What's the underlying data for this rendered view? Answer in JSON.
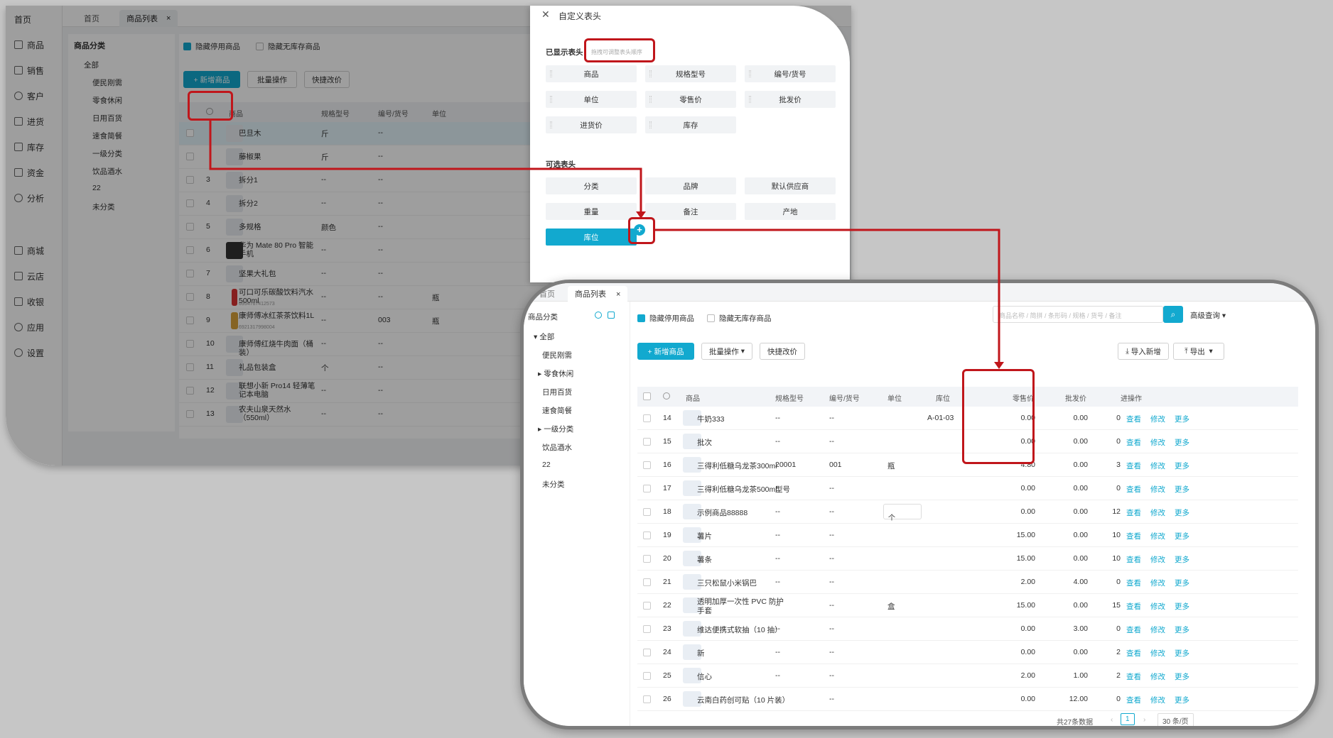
{
  "bg": {
    "tabs": [
      "首页",
      "商品列表"
    ],
    "nav": [
      "商品",
      "销售",
      "客户",
      "进货",
      "库存",
      "资金",
      "分析",
      "商城",
      "云店",
      "收银",
      "应用",
      "设置"
    ],
    "nav_cut": "首页",
    "category_title": "商品分类",
    "categories": [
      "全部",
      "便民刚需",
      "零食休闲",
      "日用百货",
      "速食简餐",
      "一级分类",
      "饮品酒水",
      "22",
      "未分类"
    ],
    "hide_disabled": "隐藏停用商品",
    "hide_nostock": "隐藏无库存商品",
    "add": "+ 新增商品",
    "batch": "批量操作",
    "quick_price": "快捷改价",
    "cols": [
      "商品",
      "规格型号",
      "编号/货号",
      "单位"
    ],
    "rows": [
      {
        "n": "",
        "name": "巴旦木",
        "spec": "斤",
        "code": "--",
        "unit": ""
      },
      {
        "n": "",
        "name": "藤椒果",
        "spec": "斤",
        "code": "--",
        "unit": ""
      },
      {
        "n": "3",
        "name": "拆分1",
        "spec": "--",
        "code": "--",
        "unit": ""
      },
      {
        "n": "4",
        "name": "拆分2",
        "spec": "--",
        "code": "--",
        "unit": ""
      },
      {
        "n": "5",
        "name": "多规格",
        "spec": "颜色",
        "code": "--",
        "unit": ""
      },
      {
        "n": "6",
        "name": "华为 Mate 80 Pro 智能手机",
        "spec": "--",
        "code": "--",
        "unit": ""
      },
      {
        "n": "7",
        "name": "坚果大礼包",
        "spec": "--",
        "code": "--",
        "unit": ""
      },
      {
        "n": "8",
        "name": "可口可乐碳酸饮料汽水500ml",
        "sub": "6954767412573",
        "spec": "--",
        "code": "--",
        "unit": "瓶"
      },
      {
        "n": "9",
        "name": "康师傅冰红茶茶饮料1L",
        "sub": "6921317998004",
        "spec": "--",
        "code": "003",
        "unit": "瓶"
      },
      {
        "n": "10",
        "name": "康师傅红烧牛肉面（桶装）",
        "spec": "--",
        "code": "--",
        "unit": ""
      },
      {
        "n": "11",
        "name": "礼品包装盒",
        "spec": "个",
        "code": "--",
        "unit": ""
      },
      {
        "n": "12",
        "name": "联想小新 Pro14 轻薄笔记本电脑",
        "spec": "--",
        "code": "--",
        "unit": ""
      },
      {
        "n": "13",
        "name": "农夫山泉天然水（550ml）",
        "spec": "--",
        "code": "--",
        "unit": ""
      }
    ]
  },
  "drawer": {
    "close": "✕",
    "title": "自定义表头",
    "shown_label": "已显示表头",
    "hint": "拖拽可调整表头顺序",
    "shown": [
      "商品",
      "规格型号",
      "编号/货号",
      "单位",
      "零售价",
      "批发价",
      "进货价",
      "库存"
    ],
    "optional_label": "可选表头",
    "optional": [
      "分类",
      "品牌",
      "默认供应商",
      "重量",
      "备注",
      "产地",
      "库位"
    ]
  },
  "fg": {
    "tabs": [
      "首页",
      "商品列表"
    ],
    "category_title": "商品分类",
    "categories": [
      "全部",
      "便民刚需",
      "零食休闲",
      "日用百货",
      "速食简餐",
      "一级分类",
      "饮品酒水",
      "22",
      "未分类"
    ],
    "hide_disabled": "隐藏停用商品",
    "hide_nostock": "隐藏无库存商品",
    "search_placeholder": "商品名称 / 简拼 / 条形码 / 规格 / 货号 / 备注",
    "adv": "高级查询",
    "add": "+ 新增商品",
    "batch": "批量操作",
    "quick_price": "快捷改价",
    "import": "导入新增",
    "export": "导出",
    "cols": {
      "name": "商品",
      "spec": "规格型号",
      "code": "编号/货号",
      "unit": "单位",
      "loc": "库位",
      "retail": "零售价",
      "whole": "批发价",
      "buy": "进",
      "op": "操作"
    },
    "actions": [
      "查看",
      "修改",
      "更多"
    ],
    "rows": [
      {
        "n": "14",
        "name": "牛奶333",
        "spec": "--",
        "code": "--",
        "unit": "",
        "loc": "A-01-03",
        "retail": "0.00",
        "whole": "0.00",
        "buy": "0"
      },
      {
        "n": "15",
        "name": "批次",
        "spec": "--",
        "code": "--",
        "unit": "",
        "loc": "",
        "retail": "0.00",
        "whole": "0.00",
        "buy": "0"
      },
      {
        "n": "16",
        "name": "三得利低糖乌龙茶300ml",
        "spec": "20001",
        "code": "001",
        "unit": "瓶",
        "loc": "",
        "retail": "4.80",
        "whole": "0.00",
        "buy": "3"
      },
      {
        "n": "17",
        "name": "三得利低糖乌龙茶500ml",
        "spec": "型号",
        "code": "--",
        "unit": "",
        "loc": "",
        "retail": "0.00",
        "whole": "0.00",
        "buy": "0"
      },
      {
        "n": "18",
        "name": "示例商品88888",
        "spec": "--",
        "code": "--",
        "unit": "个",
        "loc": "",
        "retail": "0.00",
        "whole": "0.00",
        "buy": "12"
      },
      {
        "n": "19",
        "name": "薯片",
        "spec": "--",
        "code": "--",
        "unit": "",
        "loc": "",
        "retail": "15.00",
        "whole": "0.00",
        "buy": "10"
      },
      {
        "n": "20",
        "name": "薯条",
        "spec": "--",
        "code": "--",
        "unit": "",
        "loc": "",
        "retail": "15.00",
        "whole": "0.00",
        "buy": "10"
      },
      {
        "n": "21",
        "name": "三只松鼠小米锅巴",
        "spec": "--",
        "code": "--",
        "unit": "",
        "loc": "",
        "retail": "2.00",
        "whole": "4.00",
        "buy": "0"
      },
      {
        "n": "22",
        "name": "透明加厚一次性 PVC 防护手套",
        "spec": "--",
        "code": "--",
        "unit": "盒",
        "loc": "",
        "retail": "15.00",
        "whole": "0.00",
        "buy": "15"
      },
      {
        "n": "23",
        "name": "维达便携式软抽（10 抽）",
        "spec": "--",
        "code": "--",
        "unit": "",
        "loc": "",
        "retail": "0.00",
        "whole": "3.00",
        "buy": "0"
      },
      {
        "n": "24",
        "name": "新",
        "spec": "--",
        "code": "--",
        "unit": "",
        "loc": "",
        "retail": "0.00",
        "whole": "0.00",
        "buy": "2"
      },
      {
        "n": "25",
        "name": "信心",
        "spec": "--",
        "code": "--",
        "unit": "",
        "loc": "",
        "retail": "2.00",
        "whole": "1.00",
        "buy": "2"
      },
      {
        "n": "26",
        "name": "云南白药创可贴（10 片装）",
        "spec": "--",
        "code": "--",
        "unit": "",
        "loc": "",
        "retail": "0.00",
        "whole": "12.00",
        "buy": "0"
      }
    ],
    "total": "共27条数据",
    "page": "1",
    "page_size": "30 条/页"
  },
  "accent": "#12a9cf",
  "highlight": "#c0161b"
}
